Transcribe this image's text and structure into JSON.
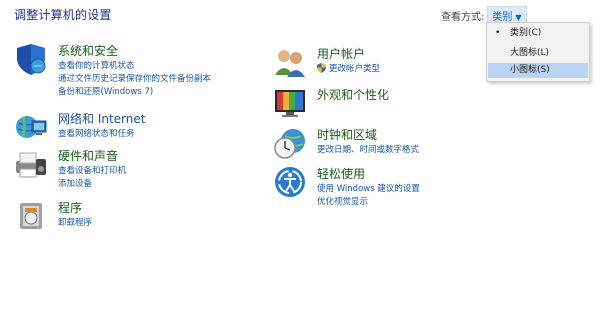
{
  "header": {
    "title": "调整计算机的设置",
    "view_by_label": "查看方式:",
    "view_by_value": "类别"
  },
  "view_menu": {
    "items": [
      {
        "label": "类别(C)",
        "selected": true
      },
      {
        "label": "大图标(L)",
        "selected": false
      },
      {
        "label": "小图标(S)",
        "selected": false,
        "highlighted": true
      }
    ],
    "selected_mark": "•"
  },
  "categories": {
    "system": {
      "title": "系统和安全",
      "links": [
        "查看你的计算机状态",
        "通过文件历史记录保存你的文件备份副本",
        "备份和还原(Windows 7)"
      ],
      "icon": "shield-icon"
    },
    "network": {
      "title": "网络和 Internet",
      "links": [
        "查看网络状态和任务"
      ],
      "icon": "globe-network-icon"
    },
    "hardware": {
      "title": "硬件和声音",
      "links": [
        "查看设备和打印机",
        "添加设备"
      ],
      "icon": "printer-icon"
    },
    "programs": {
      "title": "程序",
      "links": [
        "卸载程序"
      ],
      "icon": "programs-icon"
    },
    "accounts": {
      "title": "用户帐户",
      "links": [
        "更改帐户类型"
      ],
      "icon": "users-icon"
    },
    "appearance": {
      "title": "外观和个性化",
      "links": [],
      "icon": "monitor-icon"
    },
    "clock": {
      "title": "时钟和区域",
      "links": [
        "更改日期、时间或数字格式"
      ],
      "icon": "clock-globe-icon"
    },
    "ease": {
      "title": "轻松使用",
      "links": [
        "使用 Windows 建议的设置",
        "优化视觉显示"
      ],
      "icon": "ease-of-access-icon"
    }
  }
}
